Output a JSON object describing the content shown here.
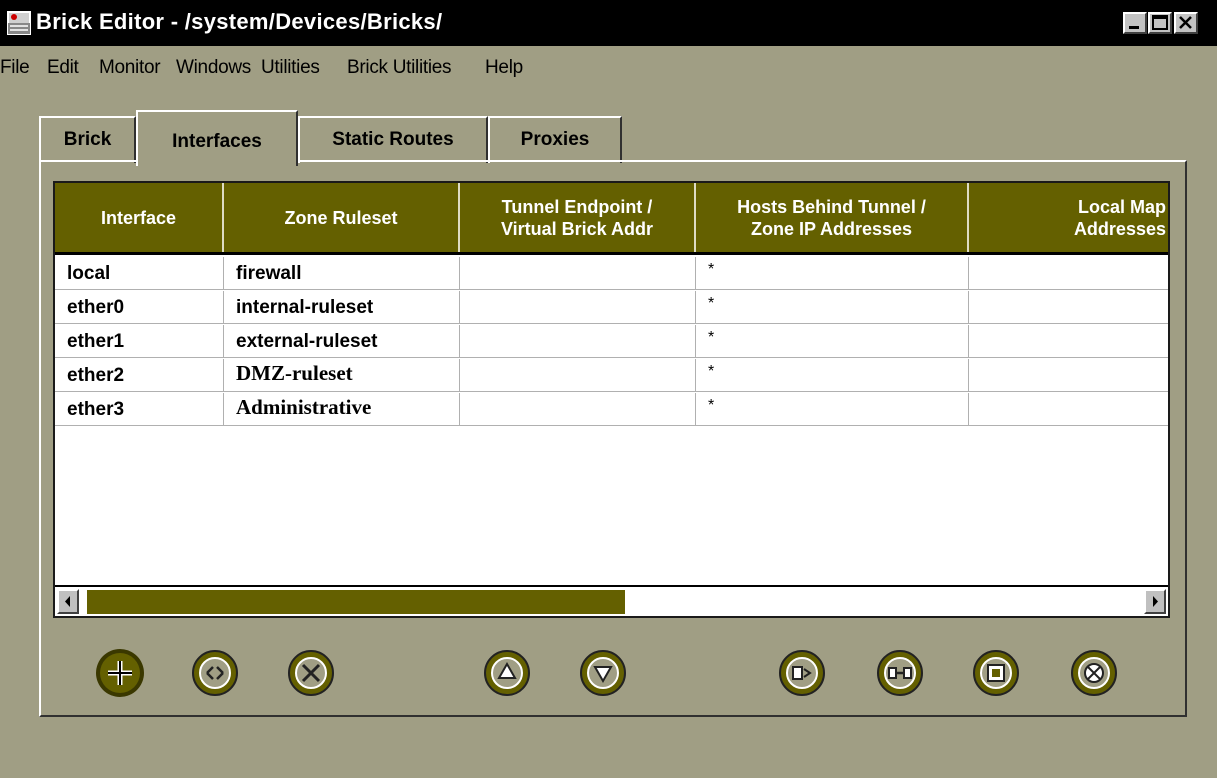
{
  "window": {
    "title": "Brick Editor - /system/Devices/Bricks/",
    "controls": [
      "minimize",
      "maximize",
      "close"
    ]
  },
  "menubar": {
    "items": [
      "File",
      "Edit",
      "Monitor",
      "Windows",
      "Utilities",
      "Brick Utilities",
      "Help"
    ]
  },
  "tabs": {
    "items": [
      "Brick",
      "Interfaces",
      "Static Routes",
      "Proxies"
    ],
    "active": "Interfaces"
  },
  "table": {
    "columns": [
      [
        "Interface"
      ],
      [
        "Zone Ruleset"
      ],
      [
        "Tunnel Endpoint /",
        "Virtual Brick Addr"
      ],
      [
        "Hosts Behind Tunnel /",
        "Zone IP Addresses"
      ],
      [
        "Local Map",
        "Addresses"
      ]
    ],
    "rows": [
      [
        "local",
        "firewall",
        "",
        "*",
        ""
      ],
      [
        "ether0",
        "internal-ruleset",
        "",
        "*",
        ""
      ],
      [
        "ether1",
        "external-ruleset",
        "",
        "*",
        ""
      ],
      [
        "ether2",
        "DMZ-ruleset",
        "",
        "*",
        ""
      ],
      [
        "ether3",
        "Administrative",
        "",
        "*",
        ""
      ]
    ]
  },
  "scrollbar": {
    "position": 0.0,
    "visible_fraction": 0.5
  },
  "toolbar": {
    "buttons": [
      {
        "icon": "add-icon"
      },
      {
        "icon": "edit-icon"
      },
      {
        "icon": "delete-icon"
      },
      {
        "icon": "move-up-icon"
      },
      {
        "icon": "move-down-icon"
      },
      {
        "icon": "interface-icon"
      },
      {
        "icon": "link-icon"
      },
      {
        "icon": "frame-icon"
      },
      {
        "icon": "disable-icon"
      }
    ]
  },
  "colors": {
    "background": "#a09e84",
    "header": "#646000",
    "titlebar": "#000000"
  }
}
